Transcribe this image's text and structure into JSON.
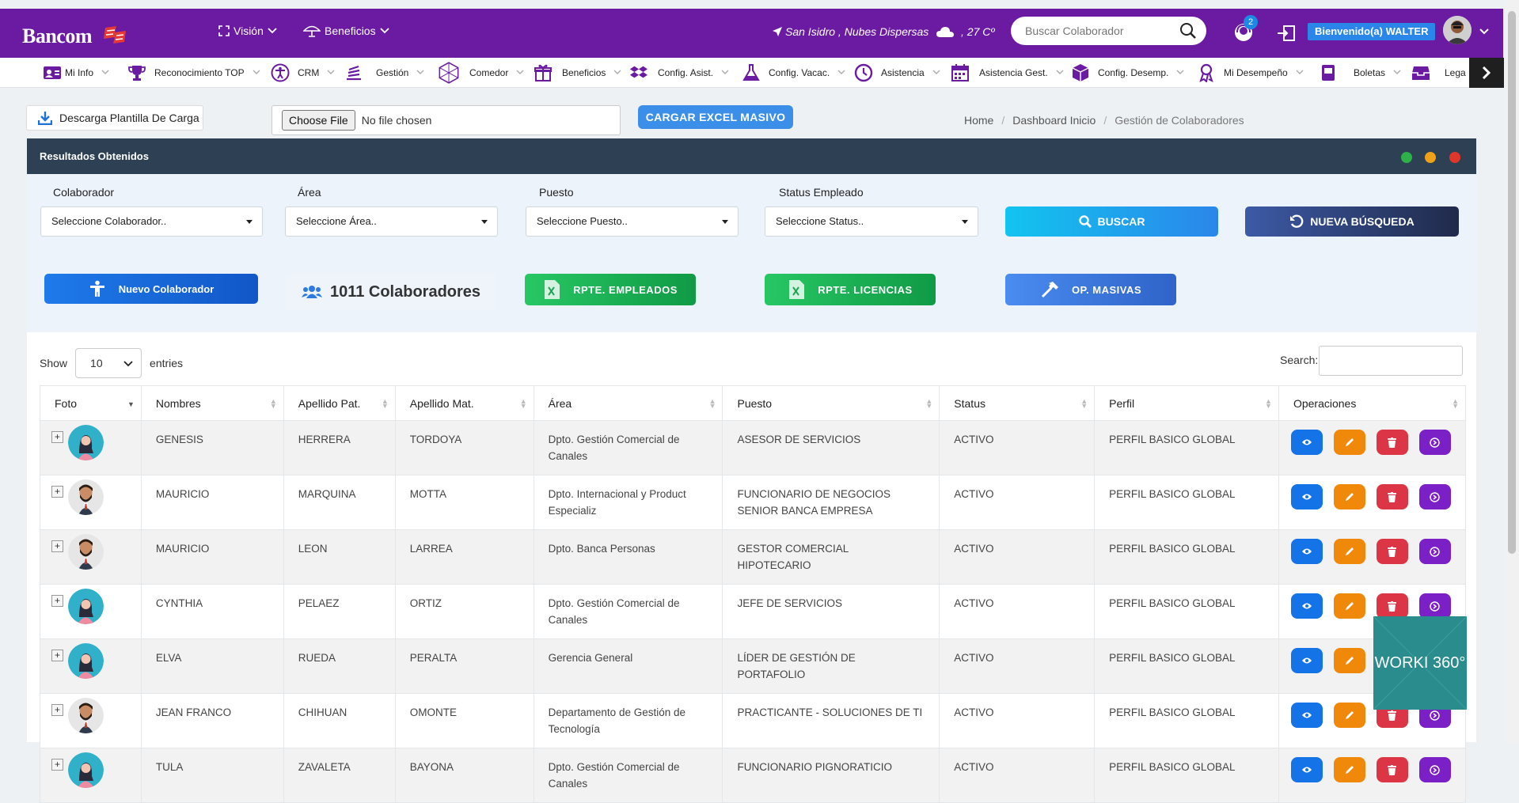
{
  "app": {
    "brand": "Bancom",
    "menus": [
      "Visión",
      "Beneficios"
    ],
    "location": "San Isidro , Nubes Dispersas",
    "temperature": ", 27 Cº",
    "search_placeholder": "Buscar Colaborador",
    "notifications": "2",
    "welcome": "Bienvenido(a) WALTER"
  },
  "menubar": [
    {
      "label": "Mi Info",
      "icon": "id-card-icon"
    },
    {
      "label": "Reconocimiento TOP",
      "icon": "trophy-icon"
    },
    {
      "label": "CRM",
      "icon": "accessibility-icon"
    },
    {
      "label": "Gestión",
      "icon": "stack-icon"
    },
    {
      "label": "Comedor",
      "icon": "hexagon-icon"
    },
    {
      "label": "Beneficios",
      "icon": "gift-icon"
    },
    {
      "label": "Config. Asist.",
      "icon": "dropbox-icon"
    },
    {
      "label": "Config. Vacac.",
      "icon": "flask-icon"
    },
    {
      "label": "Asistencia",
      "icon": "clock-icon"
    },
    {
      "label": "Asistencia Gest.",
      "icon": "calendar-icon"
    },
    {
      "label": "Config. Desemp.",
      "icon": "cube-icon"
    },
    {
      "label": "Mi Desempeño",
      "icon": "award-icon"
    },
    {
      "label": "Boletas",
      "icon": "document-icon"
    },
    {
      "label": "Lega",
      "icon": "archive-icon"
    }
  ],
  "actions": {
    "download_template": "Descarga Plantilla De Carga",
    "choose_file": "Choose File",
    "no_file": "No file chosen",
    "bulk_upload": "CARGAR EXCEL MASIVO"
  },
  "breadcrumb": [
    "Home",
    "Dashboard Inicio",
    "Gestión de Colaboradores"
  ],
  "panel": {
    "title": "Resultados Obtenidos"
  },
  "filters": [
    {
      "label": "Colaborador",
      "value": "Seleccione Colaborador.."
    },
    {
      "label": "Área",
      "value": "Seleccione Área.."
    },
    {
      "label": "Puesto",
      "value": "Seleccione Puesto.."
    },
    {
      "label": "Status Empleado",
      "value": "Seleccione Status.."
    }
  ],
  "buttons": {
    "search": "BUSCAR",
    "new_search": "NUEVA BÚSQUEDA",
    "new_collab": "Nuevo Colaborador",
    "collab_count": "1011 Colaboradores",
    "report_employees": "RPTE. EMPLEADOS",
    "report_licenses": "RPTE. LICENCIAS",
    "mass_ops": "OP. MASIVAS"
  },
  "table_controls": {
    "show": "Show",
    "entries_value": "10",
    "entries": "entries",
    "search": "Search:"
  },
  "table": {
    "headers": [
      "Foto",
      "Nombres",
      "Apellido Pat.",
      "Apellido Mat.",
      "Área",
      "Puesto",
      "Status",
      "Perfil",
      "Operaciones"
    ],
    "rows": [
      {
        "avatar": "female",
        "nombres": "GENESIS",
        "ap_pat": "HERRERA",
        "ap_mat": "TORDOYA",
        "area": "Dpto. Gestión Comercial de Canales",
        "puesto": "ASESOR DE SERVICIOS",
        "status": "ACTIVO",
        "perfil": "PERFIL BASICO GLOBAL"
      },
      {
        "avatar": "male",
        "nombres": "MAURICIO",
        "ap_pat": "MARQUINA",
        "ap_mat": "MOTTA",
        "area": "Dpto. Internacional y Product Especializ",
        "puesto": "FUNCIONARIO DE NEGOCIOS SENIOR BANCA EMPRESA",
        "status": "ACTIVO",
        "perfil": "PERFIL BASICO GLOBAL"
      },
      {
        "avatar": "male",
        "nombres": "MAURICIO",
        "ap_pat": "LEON",
        "ap_mat": "LARREA",
        "area": "Dpto. Banca Personas",
        "puesto": "GESTOR COMERCIAL HIPOTECARIO",
        "status": "ACTIVO",
        "perfil": "PERFIL BASICO GLOBAL"
      },
      {
        "avatar": "female",
        "nombres": "CYNTHIA",
        "ap_pat": "PELAEZ",
        "ap_mat": "ORTIZ",
        "area": "Dpto. Gestión Comercial de Canales",
        "puesto": "JEFE DE SERVICIOS",
        "status": "ACTIVO",
        "perfil": "PERFIL BASICO GLOBAL"
      },
      {
        "avatar": "female",
        "nombres": "ELVA",
        "ap_pat": "RUEDA",
        "ap_mat": "PERALTA",
        "area": "Gerencia General",
        "puesto": "LÍDER DE GESTIÓN DE PORTAFOLIO",
        "status": "ACTIVO",
        "perfil": "PERFIL BASICO GLOBAL"
      },
      {
        "avatar": "male",
        "nombres": "JEAN FRANCO",
        "ap_pat": "CHIHUAN",
        "ap_mat": "OMONTE",
        "area": "Departamento de Gestión de Tecnología",
        "puesto": "PRACTICANTE - SOLUCIONES DE TI",
        "status": "ACTIVO",
        "perfil": "PERFIL BASICO GLOBAL"
      },
      {
        "avatar": "female",
        "nombres": "TULA",
        "ap_pat": "ZAVALETA",
        "ap_mat": "BAYONA",
        "area": "Dpto. Gestión Comercial de Canales",
        "puesto": "FUNCIONARIO PIGNORATICIO",
        "status": "ACTIVO",
        "perfil": "PERFIL BASICO GLOBAL"
      }
    ]
  },
  "colors": {
    "topbar": "#6a1ba2",
    "panel_head": "#2e4053",
    "view": "#1473e6",
    "edit": "#f0880a",
    "delete": "#dc3545",
    "more": "#7b1fc7"
  },
  "watermark": "WORKI 360°"
}
